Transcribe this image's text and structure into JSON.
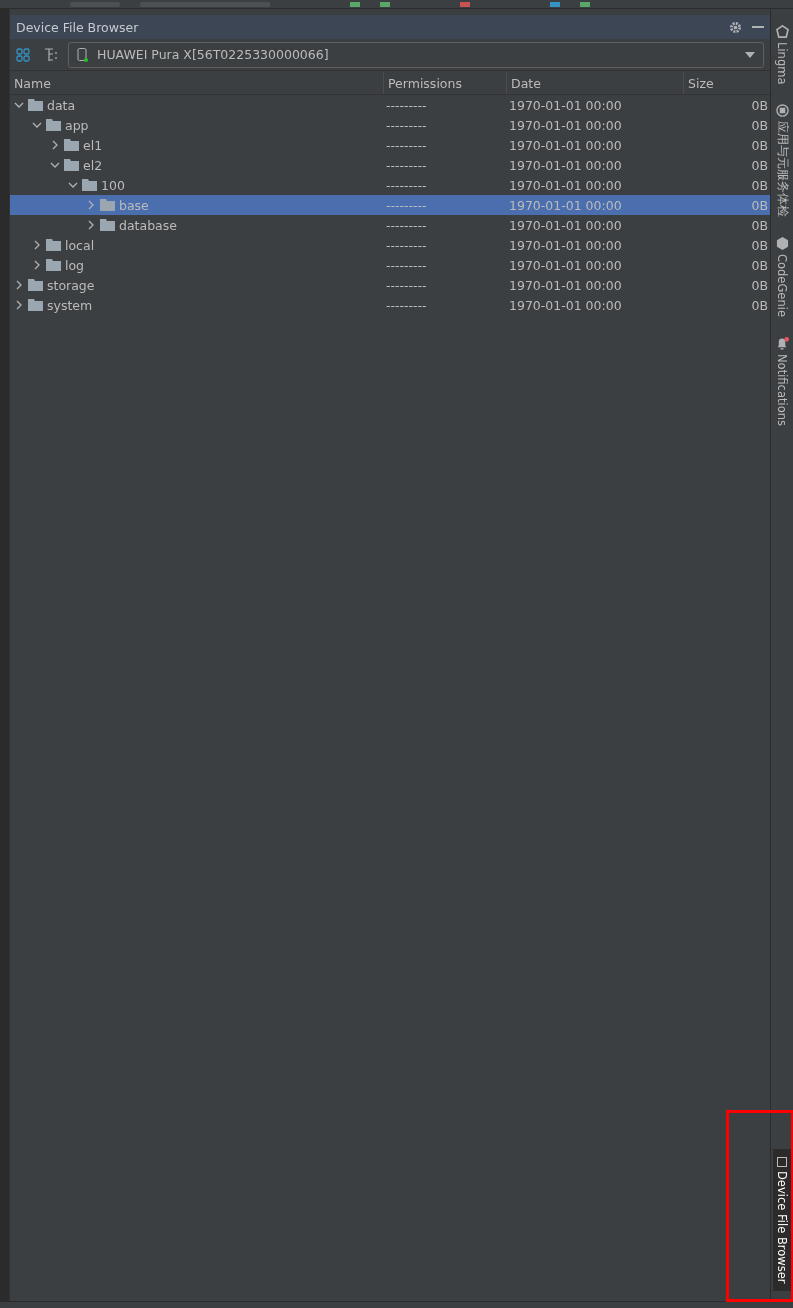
{
  "panel": {
    "title": "Device File Browser"
  },
  "device_selector": {
    "value": "HUAWEI Pura X[56T0225330000066]",
    "connected": true
  },
  "table": {
    "columns": [
      "Name",
      "Permissions",
      "Date",
      "Size"
    ],
    "rows": [
      {
        "name": "data",
        "permissions": "---------",
        "date": "1970-01-01 00:00",
        "size": "0B",
        "expanded": true,
        "selected": false,
        "children": [
          {
            "name": "app",
            "permissions": "---------",
            "date": "1970-01-01 00:00",
            "size": "0B",
            "expanded": true,
            "selected": false,
            "children": [
              {
                "name": "el1",
                "permissions": "---------",
                "date": "1970-01-01 00:00",
                "size": "0B",
                "expanded": false,
                "selected": false
              },
              {
                "name": "el2",
                "permissions": "---------",
                "date": "1970-01-01 00:00",
                "size": "0B",
                "expanded": true,
                "selected": false,
                "children": [
                  {
                    "name": "100",
                    "permissions": "---------",
                    "date": "1970-01-01 00:00",
                    "size": "0B",
                    "expanded": true,
                    "selected": false,
                    "children": [
                      {
                        "name": "base",
                        "permissions": "---------",
                        "date": "1970-01-01 00:00",
                        "size": "0B",
                        "expanded": false,
                        "selected": true
                      },
                      {
                        "name": "database",
                        "permissions": "---------",
                        "date": "1970-01-01 00:00",
                        "size": "0B",
                        "expanded": false,
                        "selected": false
                      }
                    ]
                  }
                ]
              }
            ]
          },
          {
            "name": "local",
            "permissions": "---------",
            "date": "1970-01-01 00:00",
            "size": "0B",
            "expanded": false,
            "selected": false
          },
          {
            "name": "log",
            "permissions": "---------",
            "date": "1970-01-01 00:00",
            "size": "0B",
            "expanded": false,
            "selected": false
          }
        ]
      },
      {
        "name": "storage",
        "permissions": "---------",
        "date": "1970-01-01 00:00",
        "size": "0B",
        "expanded": false,
        "selected": false
      },
      {
        "name": "system",
        "permissions": "---------",
        "date": "1970-01-01 00:00",
        "size": "0B",
        "expanded": false,
        "selected": false
      }
    ]
  },
  "right_sidebar": {
    "top_items": [
      {
        "label": "Lingma",
        "kind": "lingma",
        "badge": false
      },
      {
        "label": "应用与元服务体检",
        "kind": "check",
        "badge": false
      },
      {
        "label": "CodeGenie",
        "kind": "genie",
        "badge": false
      },
      {
        "label": "Notifications",
        "kind": "bell",
        "badge": true
      }
    ],
    "bottom_items": [
      {
        "label": "Device File Browser",
        "kind": "device",
        "selected": true
      }
    ]
  }
}
